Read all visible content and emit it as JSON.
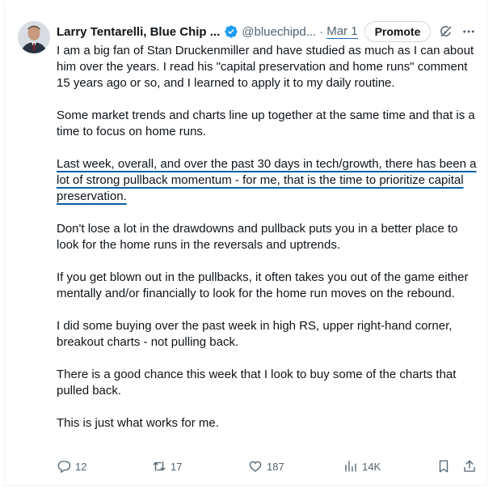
{
  "author": {
    "name": "Larry Tentarelli, Blue Chip ...",
    "handle": "@bluechipd...",
    "separator": "·",
    "date": "Mar 1",
    "promote_label": "Promote"
  },
  "body": {
    "p1": "I am a big fan of Stan Druckenmiller and have studied as much as I can about him over the years. I read his \"capital preservation and home runs\" comment 15 years ago or so, and I learned to apply it to my daily routine.",
    "p2": "Some market trends and charts line up together at the same time and that is a time to focus on home runs.",
    "p3": "Last week, overall, and over the past 30 days in tech/growth, there has been a lot of strong pullback momentum - for me, that is the time to prioritize capital preservation.",
    "p4": "Don't lose a lot in the drawdowns and pullback puts you in a better place to look for the home runs in the reversals and uptrends.",
    "p5": "If you get blown out in the pullbacks, it often takes you out of the game either mentally and/or financially to look for the home run moves on the rebound.",
    "p6": "I did some buying over the past week in high RS, upper right-hand corner, breakout charts - not pulling back.",
    "p7": "There is a good chance this week that I look to buy some of the charts that pulled back.",
    "p8": "This is just what works for me."
  },
  "actions": {
    "replies": "12",
    "reposts": "17",
    "likes": "187",
    "views": "14K"
  },
  "colors": {
    "verified": "#1d9bf0",
    "annotation_underline": "#0b5ea8",
    "muted": "#536471"
  },
  "icons": [
    "verified-badge-icon",
    "grok-icon",
    "more-icon",
    "reply-icon",
    "repost-icon",
    "like-icon",
    "views-icon",
    "bookmark-icon",
    "share-icon"
  ]
}
